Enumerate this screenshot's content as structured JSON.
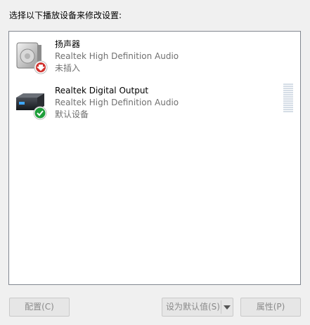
{
  "instruction": "选择以下播放设备来修改设置:",
  "devices": [
    {
      "name": "扬声器",
      "description": "Realtek High Definition Audio",
      "status": "未插入",
      "icon": "speaker-icon",
      "badge": "unplugged-red-arrow-icon",
      "selected": false
    },
    {
      "name": "Realtek Digital Output",
      "description": "Realtek High Definition Audio",
      "status": "默认设备",
      "icon": "digital-output-icon",
      "badge": "default-green-check-icon",
      "selected": false,
      "level": 0
    }
  ],
  "buttons": {
    "configure": "配置(C)",
    "set_default": "设为默认值(S)",
    "properties": "属性(P)"
  },
  "colors": {
    "badge_red": "#d0312d",
    "badge_green": "#1e9e3a",
    "disabled_text": "#8a8a8a"
  }
}
